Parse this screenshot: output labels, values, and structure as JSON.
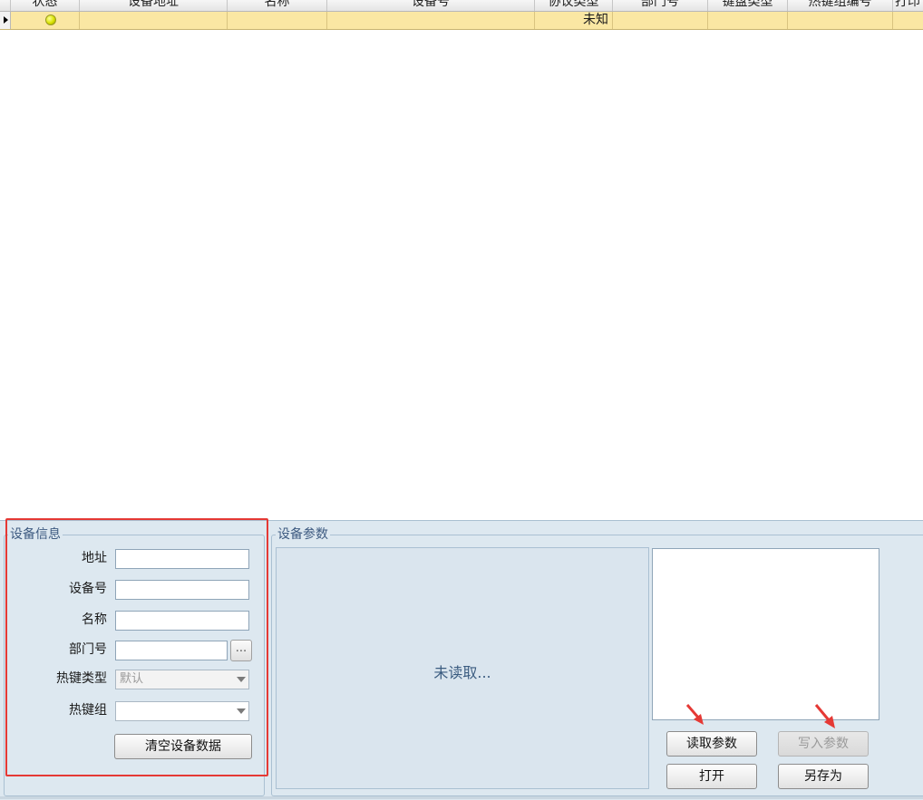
{
  "grid": {
    "columns": [
      "状态",
      "设备地址",
      "名称",
      "设备号",
      "协议类型",
      "部门号",
      "键盘类型",
      "热键组编号",
      "打印"
    ],
    "rows": [
      {
        "status": "yellow",
        "address": "",
        "name": "",
        "device_no": "",
        "protocol": "未知",
        "dept": "",
        "keyboard": "",
        "hotkey_group_no": "",
        "print": ""
      }
    ]
  },
  "device_info": {
    "legend": "设备信息",
    "address_label": "地址",
    "address_value": "",
    "device_no_label": "设备号",
    "device_no_value": "",
    "name_label": "名称",
    "name_value": "",
    "dept_label": "部门号",
    "dept_value": "",
    "browse_label": "...",
    "hotkey_type_label": "热键类型",
    "hotkey_type_value": "默认",
    "hotkey_group_label": "热键组",
    "hotkey_group_value": "",
    "clear_button": "清空设备数据"
  },
  "device_params": {
    "legend": "设备参数",
    "status_text": "未读取...",
    "read_button": "读取参数",
    "write_button": "写入参数",
    "open_button": "打开",
    "save_as_button": "另存为"
  },
  "colors": {
    "selected_row": "#fae7a3",
    "panel_bg": "#dde8f0",
    "highlight": "#e53935",
    "arrow": "#e53935"
  }
}
